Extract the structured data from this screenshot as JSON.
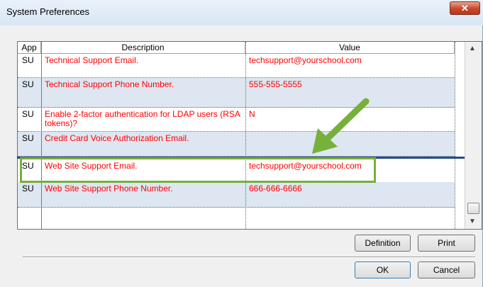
{
  "window": {
    "title": "System Preferences",
    "close_glyph": "✕"
  },
  "grid": {
    "columns": [
      "App",
      "Description",
      "Value"
    ],
    "rows": [
      {
        "app": "SU",
        "description": "Technical Support Email.",
        "value": "techsupport@yourschool.com"
      },
      {
        "app": "SU",
        "description": "Technical Support Phone Number.",
        "value": "555-555-5555"
      },
      {
        "app": "SU",
        "description": "Enable 2-factor authentication for LDAP users (RSA tokens)?",
        "value": "N"
      },
      {
        "app": "SU",
        "description": "Credit Card Voice Authorization Email.",
        "value": ""
      },
      {
        "app": "SU",
        "description": "Web Site Support Email.",
        "value": "techsupport@yourschool.com"
      },
      {
        "app": "SU",
        "description": "Web Site Support Phone Number.",
        "value": "666-666-6666"
      },
      {
        "app": "",
        "description": "",
        "value": ""
      }
    ],
    "selected_row": 4
  },
  "buttons": {
    "definition": "Definition",
    "print": "Print",
    "ok": "OK",
    "cancel": "Cancel"
  },
  "annotation": {
    "arrow_color": "#77b03a",
    "highlight_color": "#77b03a"
  },
  "icons": {
    "scroll_up": "scroll-up-icon",
    "scroll_down": "scroll-down-icon"
  }
}
